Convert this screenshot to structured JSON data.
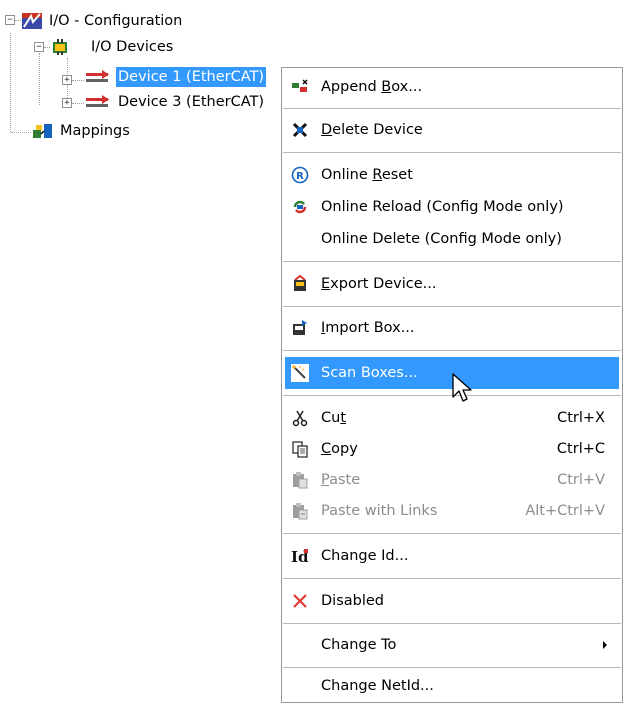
{
  "tree": {
    "root": {
      "label": "I/O - Configuration",
      "icon": "io-config-icon",
      "expander": "−"
    },
    "devices": {
      "label": "I/O Devices",
      "icon": "io-devices-icon",
      "expander": "−"
    },
    "device1": {
      "label": "Device 1 (EtherCAT)",
      "icon": "ethercat-device-icon",
      "expander": "+"
    },
    "device3": {
      "label": "Device 3 (EtherCAT)",
      "icon": "ethercat-device-icon",
      "expander": "+"
    },
    "mappings": {
      "label": "Mappings",
      "icon": "mappings-icon"
    }
  },
  "menu": {
    "append_box": {
      "pre": "Append ",
      "ul": "B",
      "post": "ox..."
    },
    "delete_device": {
      "pre": "",
      "ul": "D",
      "post": "elete Device"
    },
    "online_reset": {
      "pre": "Online ",
      "ul": "R",
      "post": "eset"
    },
    "online_reload": {
      "label": "Online Reload (Config Mode only)"
    },
    "online_delete": {
      "label": "Online Delete (Config Mode only)"
    },
    "export_device": {
      "pre": "",
      "ul": "E",
      "post": "xport Device..."
    },
    "import_box": {
      "pre": "",
      "ul": "I",
      "post": "mport Box..."
    },
    "scan_boxes": {
      "label": "Scan Boxes..."
    },
    "cut": {
      "pre": "Cu",
      "ul": "t",
      "post": "",
      "shortcut": "Ctrl+X"
    },
    "copy": {
      "pre": "",
      "ul": "C",
      "post": "opy",
      "shortcut": "Ctrl+C"
    },
    "paste": {
      "pre": "",
      "ul": "P",
      "post": "aste",
      "shortcut": "Ctrl+V"
    },
    "paste_links": {
      "label": "Paste with Links",
      "shortcut": "Alt+Ctrl+V"
    },
    "change_id": {
      "label": "Change Id..."
    },
    "disabled": {
      "label": "Disabled"
    },
    "change_to": {
      "label": "Change To"
    },
    "change_netid": {
      "label": "Change NetId..."
    }
  },
  "colors": {
    "selection": "#3399ff",
    "disabled_text": "#8d8d8d",
    "separator": "#b9b9b9"
  }
}
